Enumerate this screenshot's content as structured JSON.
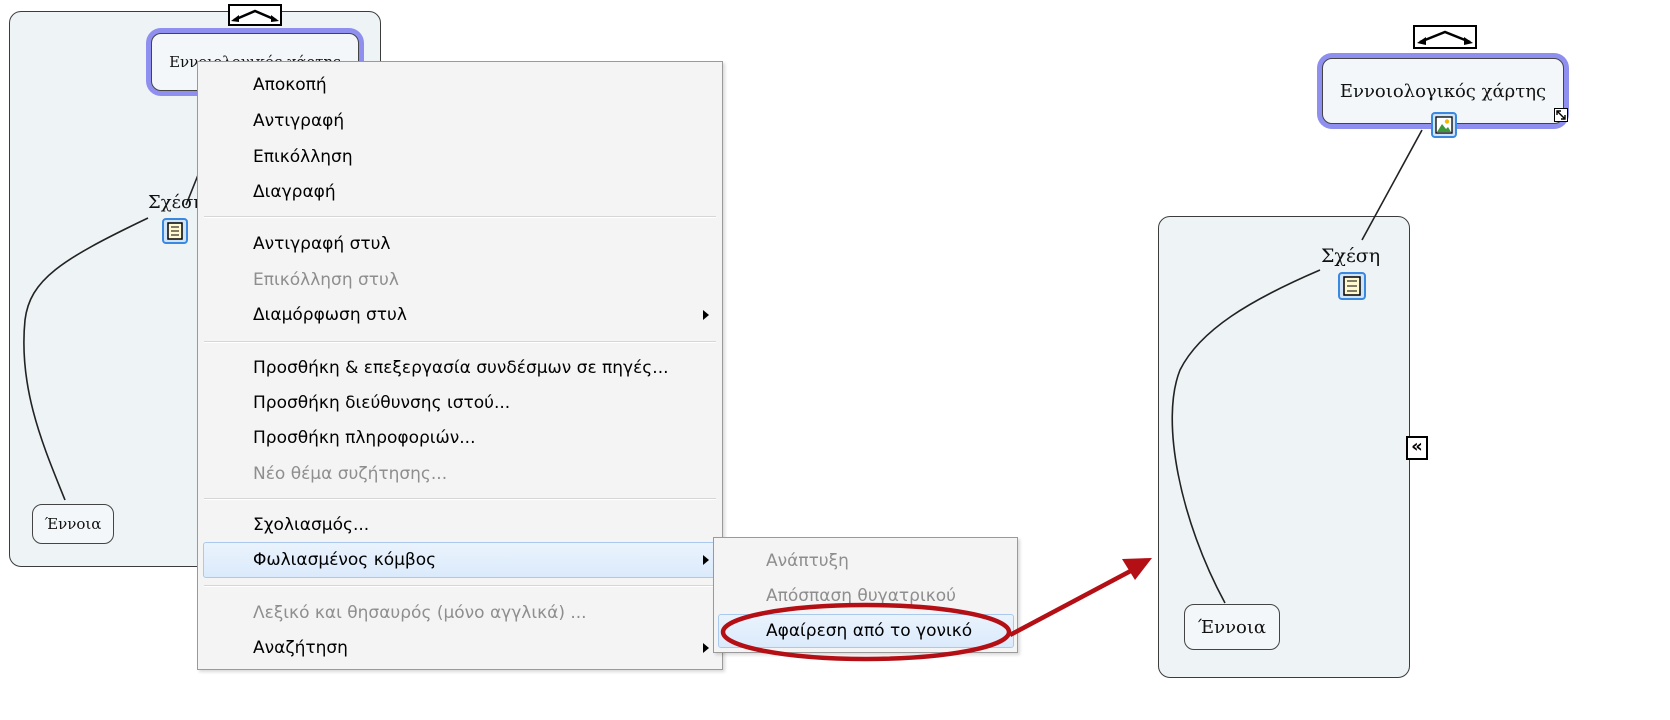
{
  "left_map": {
    "root_label": "Εννοιολογικός χάρτης",
    "link_label": "Σχέση",
    "concept_label": "Έννοια"
  },
  "context_menu": {
    "items": [
      {
        "label": "Αποκοπή",
        "enabled": true
      },
      {
        "label": "Αντιγραφή",
        "enabled": true
      },
      {
        "label": "Επικόλληση",
        "enabled": true
      },
      {
        "label": "Διαγραφή",
        "enabled": true
      },
      {
        "label": "Αντιγραφή στυλ",
        "enabled": true
      },
      {
        "label": "Επικόλληση στυλ",
        "enabled": false
      },
      {
        "label": "Διαμόρφωση στυλ",
        "enabled": true,
        "submenu": true
      },
      {
        "label": "Προσθήκη & επεξεργασία συνδέσμων σε πηγές...",
        "enabled": true
      },
      {
        "label": "Προσθήκη διεύθυνσης ιστού...",
        "enabled": true
      },
      {
        "label": "Προσθήκη πληροφοριών...",
        "enabled": true
      },
      {
        "label": "Νέο θέμα συζήτησης...",
        "enabled": false
      },
      {
        "label": "Σχολιασμός...",
        "enabled": true
      },
      {
        "label": "Φωλιασμένος κόμβος",
        "enabled": true,
        "submenu": true,
        "highlighted": true
      },
      {
        "label": "Λεξικό και θησαυρός (μόνο αγγλικά) ...",
        "enabled": false
      },
      {
        "label": "Αναζήτηση",
        "enabled": true,
        "submenu": true
      }
    ]
  },
  "submenu": {
    "items": [
      {
        "label": "Ανάπτυξη",
        "enabled": false
      },
      {
        "label": "Απόσπαση θυγατρικού",
        "enabled": false
      },
      {
        "label": "Αφαίρεση από το γονικό",
        "enabled": true,
        "highlighted": true
      }
    ]
  },
  "right_map": {
    "root_label": "Εννοιολογικός χάρτης",
    "link_label": "Σχέση",
    "concept_label": "Έννοια",
    "collapse_glyph": "«"
  },
  "colors": {
    "annotation_red": "#b30f14",
    "selection_halo": "#8f8ff0",
    "panel_fill": "#eef3f6"
  }
}
